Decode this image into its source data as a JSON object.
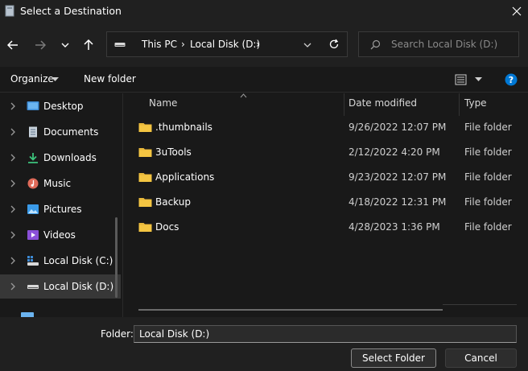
{
  "window": {
    "title": "Select a Destination"
  },
  "address": {
    "crumbs": [
      "This PC",
      "Local Disk (D:)"
    ]
  },
  "search": {
    "placeholder": "Search Local Disk (D:)"
  },
  "toolbar": {
    "organize_label": "Organize",
    "new_folder_label": "New folder"
  },
  "sidebar": {
    "items": [
      {
        "label": "Desktop",
        "icon": "desktop-icon"
      },
      {
        "label": "Documents",
        "icon": "documents-icon"
      },
      {
        "label": "Downloads",
        "icon": "downloads-icon"
      },
      {
        "label": "Music",
        "icon": "music-icon"
      },
      {
        "label": "Pictures",
        "icon": "pictures-icon"
      },
      {
        "label": "Videos",
        "icon": "videos-icon"
      },
      {
        "label": "Local Disk (C:)",
        "icon": "drive-icon"
      },
      {
        "label": "Local Disk (D:)",
        "icon": "drive-icon",
        "selected": true
      }
    ]
  },
  "columns": {
    "name": "Name",
    "date": "Date modified",
    "type": "Type"
  },
  "files": [
    {
      "name": ".thumbnails",
      "date": "9/26/2022 12:07 PM",
      "type": "File folder"
    },
    {
      "name": "3uTools",
      "date": "2/12/2022 4:20 PM",
      "type": "File folder"
    },
    {
      "name": "Applications",
      "date": "9/23/2022 12:07 PM",
      "type": "File folder"
    },
    {
      "name": "Backup",
      "date": "4/18/2022 12:31 PM",
      "type": "File folder"
    },
    {
      "name": "Docs",
      "date": "4/28/2023 1:36 PM",
      "type": "File folder"
    }
  ],
  "footer": {
    "folder_label": "Folder:",
    "folder_value": "Local Disk (D:)",
    "select_label": "Select Folder",
    "cancel_label": "Cancel"
  },
  "colors": {
    "accent": "#0078d4",
    "folder": "#f4c542",
    "background": "#191919"
  }
}
